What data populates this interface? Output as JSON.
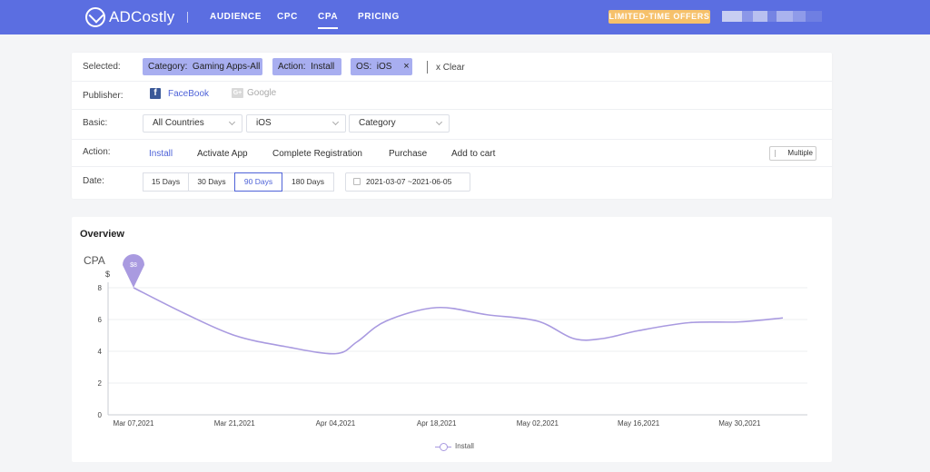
{
  "header": {
    "logo_text": "ADCostly",
    "nav": [
      {
        "label": "AUDIENCE",
        "active": false
      },
      {
        "label": "CPC",
        "active": false
      },
      {
        "label": "CPA",
        "active": true
      },
      {
        "label": "PRICING",
        "active": false
      }
    ],
    "offer_label": "LIMITED-TIME OFFERS"
  },
  "filters": {
    "selected_label": "Selected:",
    "tags": [
      {
        "key": "Category:",
        "value": "Gaming Apps-All",
        "removable": false
      },
      {
        "key": "Action:",
        "value": "Install",
        "removable": false
      },
      {
        "key": "OS:",
        "value": "iOS",
        "removable": true
      }
    ],
    "tag_remove_glyph": "×",
    "clear_label": "x Clear",
    "publisher_label": "Publisher:",
    "publishers": [
      {
        "name": "FaceBook",
        "icon_glyph": "f",
        "active": true
      },
      {
        "name": "Google",
        "icon_glyph": "G+",
        "active": false
      }
    ],
    "basic_label": "Basic:",
    "selects": [
      {
        "value": "All Countries"
      },
      {
        "value": "iOS"
      },
      {
        "value": "Category"
      }
    ],
    "action_label": "Action:",
    "actions": [
      {
        "label": "Install",
        "active": true
      },
      {
        "label": "Activate App",
        "active": false
      },
      {
        "label": "Complete Registration",
        "active": false
      },
      {
        "label": "Purchase",
        "active": false
      },
      {
        "label": "Add to cart",
        "active": false
      }
    ],
    "multiple_label": "Multiple",
    "date_label": "Date:",
    "date_buttons": [
      {
        "label": "15 Days",
        "active": false
      },
      {
        "label": "30 Days",
        "active": false
      },
      {
        "label": "90 Days",
        "active": true
      },
      {
        "label": "180 Days",
        "active": false
      }
    ],
    "date_range": {
      "start": "2021-03-07",
      "separator": "~",
      "end": "2021-06-05"
    }
  },
  "overview": {
    "title": "Overview"
  },
  "colors": {
    "header_bg": "#5b6ee1",
    "accent": "#4f63d8",
    "tag_bg": "#a8aef0",
    "offer_bg": "#f6c16b",
    "series_line": "#a99ae0",
    "tooltip_pin": "#a99ae0"
  },
  "chart_data": {
    "type": "line",
    "title": "CPA",
    "ylabel": "$",
    "ylim": [
      0,
      8
    ],
    "yticks": [
      0,
      2,
      4,
      6,
      8
    ],
    "x_tick_labels": [
      "Mar 07,2021",
      "Mar 21,2021",
      "Apr 04,2021",
      "Apr 18,2021",
      "May 02,2021",
      "May 16,2021",
      "May 30,2021"
    ],
    "x": [
      "2021-03-07",
      "2021-03-14",
      "2021-03-21",
      "2021-03-28",
      "2021-04-04",
      "2021-04-07",
      "2021-04-11",
      "2021-04-18",
      "2021-04-25",
      "2021-05-02",
      "2021-05-07",
      "2021-05-11",
      "2021-05-16",
      "2021-05-23",
      "2021-05-30",
      "2021-06-05"
    ],
    "series": [
      {
        "name": "Install",
        "values": [
          8.0,
          6.4,
          5.0,
          4.3,
          3.85,
          4.6,
          5.9,
          6.75,
          6.3,
          5.9,
          4.8,
          4.8,
          5.3,
          5.8,
          5.85,
          6.1
        ]
      }
    ],
    "highlight": {
      "index": 0,
      "label": "$8"
    },
    "legend": "bottom-center",
    "grid": true
  }
}
